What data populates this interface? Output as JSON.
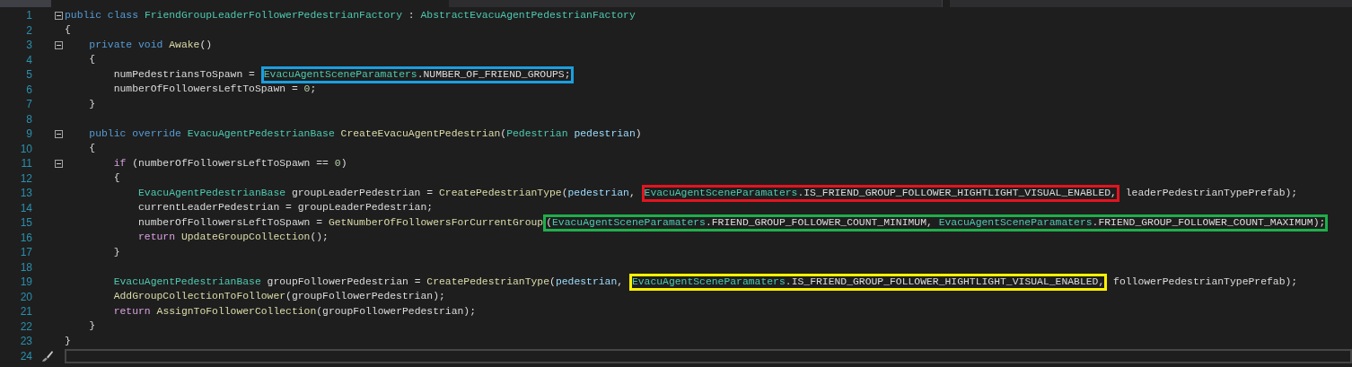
{
  "lines": [
    {
      "number": "1",
      "fold": true,
      "current": false,
      "tokens": [
        {
          "kind": "keyword",
          "text": "public class "
        },
        {
          "kind": "type",
          "text": "FriendGroupLeaderFollowerPedestrianFactory"
        },
        {
          "kind": "plain",
          "text": " : "
        },
        {
          "kind": "type",
          "text": "AbstractEvacuAgentPedestrianFactory"
        }
      ]
    },
    {
      "number": "2",
      "fold": false,
      "current": false,
      "tokens": [
        {
          "kind": "plain",
          "text": "{"
        }
      ]
    },
    {
      "number": "3",
      "fold": true,
      "current": false,
      "tokens": [
        {
          "kind": "keyword",
          "text": "    private void "
        },
        {
          "kind": "method",
          "text": "Awake"
        },
        {
          "kind": "plain",
          "text": "()"
        }
      ]
    },
    {
      "number": "4",
      "fold": false,
      "current": false,
      "tokens": [
        {
          "kind": "plain",
          "text": "    {"
        }
      ]
    },
    {
      "number": "5",
      "fold": false,
      "current": false,
      "tokens": [
        {
          "kind": "plain",
          "text": "        numPedestriansToSpawn = "
        },
        {
          "kind": "box",
          "color": "#1a9fe0",
          "tokens": [
            {
              "kind": "type",
              "text": "EvacuAgentSceneParamaters"
            },
            {
              "kind": "plain",
              "text": ".NUMBER_OF_FRIEND_GROUPS;"
            }
          ]
        }
      ]
    },
    {
      "number": "6",
      "fold": false,
      "current": false,
      "tokens": [
        {
          "kind": "plain",
          "text": "        numberOfFollowersLeftToSpawn = "
        },
        {
          "kind": "number",
          "text": "0"
        },
        {
          "kind": "plain",
          "text": ";"
        }
      ]
    },
    {
      "number": "7",
      "fold": false,
      "current": false,
      "tokens": [
        {
          "kind": "plain",
          "text": "    }"
        }
      ]
    },
    {
      "number": "8",
      "fold": false,
      "current": false
    },
    {
      "number": "9",
      "fold": true,
      "current": false,
      "tokens": [
        {
          "kind": "keyword",
          "text": "    public override "
        },
        {
          "kind": "type",
          "text": "EvacuAgentPedestrianBase "
        },
        {
          "kind": "method",
          "text": "CreateEvacuAgentPedestrian"
        },
        {
          "kind": "plain",
          "text": "("
        },
        {
          "kind": "type",
          "text": "Pedestrian "
        },
        {
          "kind": "param",
          "text": "pedestrian"
        },
        {
          "kind": "plain",
          "text": ")"
        }
      ]
    },
    {
      "number": "10",
      "fold": false,
      "current": false,
      "tokens": [
        {
          "kind": "plain",
          "text": "    {"
        }
      ]
    },
    {
      "number": "11",
      "fold": true,
      "current": false,
      "tokens": [
        {
          "kind": "control",
          "text": "        if"
        },
        {
          "kind": "plain",
          "text": " (numberOfFollowersLeftToSpawn == "
        },
        {
          "kind": "number",
          "text": "0"
        },
        {
          "kind": "plain",
          "text": ")"
        }
      ]
    },
    {
      "number": "12",
      "fold": false,
      "current": false,
      "tokens": [
        {
          "kind": "plain",
          "text": "        {"
        }
      ]
    },
    {
      "number": "13",
      "fold": false,
      "current": false,
      "tokens": [
        {
          "kind": "type",
          "text": "            EvacuAgentPedestrianBase"
        },
        {
          "kind": "plain",
          "text": " groupLeaderPedestrian = "
        },
        {
          "kind": "method",
          "text": "CreatePedestrianType"
        },
        {
          "kind": "plain",
          "text": "("
        },
        {
          "kind": "param",
          "text": "pedestrian"
        },
        {
          "kind": "plain",
          "text": ", "
        },
        {
          "kind": "box",
          "color": "#e3141f",
          "tokens": [
            {
              "kind": "type",
              "text": "EvacuAgentSceneParamaters"
            },
            {
              "kind": "plain",
              "text": ".IS_FRIEND_GROUP_FOLLOWER_HIGHTLIGHT_VISUAL_ENABLED,"
            }
          ]
        },
        {
          "kind": "plain",
          "text": " leaderPedestrianTypePrefab);"
        }
      ]
    },
    {
      "number": "14",
      "fold": false,
      "current": false,
      "tokens": [
        {
          "kind": "plain",
          "text": "            currentLeaderPedestrian = groupLeaderPedestrian;"
        }
      ]
    },
    {
      "number": "15",
      "fold": false,
      "current": false,
      "tokens": [
        {
          "kind": "plain",
          "text": "            numberOfFollowersLeftToSpawn = "
        },
        {
          "kind": "method",
          "text": "GetNumberOfFollowersForCurrentGroup"
        },
        {
          "kind": "box",
          "color": "#1fae4b",
          "tokens": [
            {
              "kind": "plain",
              "text": "("
            },
            {
              "kind": "type",
              "text": "EvacuAgentSceneParamaters"
            },
            {
              "kind": "plain",
              "text": ".FRIEND_GROUP_FOLLOWER_COUNT_MINIMUM, "
            },
            {
              "kind": "type",
              "text": "EvacuAgentSceneParamaters"
            },
            {
              "kind": "plain",
              "text": ".FRIEND_GROUP_FOLLOWER_COUNT_MAXIMUM);"
            }
          ]
        }
      ]
    },
    {
      "number": "16",
      "fold": false,
      "current": false,
      "tokens": [
        {
          "kind": "control",
          "text": "            return "
        },
        {
          "kind": "method",
          "text": "UpdateGroupCollection"
        },
        {
          "kind": "plain",
          "text": "();"
        }
      ]
    },
    {
      "number": "17",
      "fold": false,
      "current": false,
      "tokens": [
        {
          "kind": "plain",
          "text": "        }"
        }
      ]
    },
    {
      "number": "18",
      "fold": false,
      "current": false
    },
    {
      "number": "19",
      "fold": false,
      "current": false,
      "tokens": [
        {
          "kind": "type",
          "text": "        EvacuAgentPedestrianBase"
        },
        {
          "kind": "plain",
          "text": " groupFollowerPedestrian = "
        },
        {
          "kind": "method",
          "text": "CreatePedestrianType"
        },
        {
          "kind": "plain",
          "text": "("
        },
        {
          "kind": "param",
          "text": "pedestrian"
        },
        {
          "kind": "plain",
          "text": ", "
        },
        {
          "kind": "box",
          "color": "#fff200",
          "tokens": [
            {
              "kind": "type",
              "text": "EvacuAgentSceneParamaters"
            },
            {
              "kind": "plain",
              "text": ".IS_FRIEND_GROUP_FOLLOWER_HIGHTLIGHT_VISUAL_ENABLED,"
            }
          ]
        },
        {
          "kind": "plain",
          "text": " followerPedestrianTypePrefab);"
        }
      ]
    },
    {
      "number": "20",
      "fold": false,
      "current": false,
      "tokens": [
        {
          "kind": "method",
          "text": "        AddGroupCollectionToFollower"
        },
        {
          "kind": "plain",
          "text": "(groupFollowerPedestrian);"
        }
      ]
    },
    {
      "number": "21",
      "fold": false,
      "current": false,
      "tokens": [
        {
          "kind": "control",
          "text": "        return "
        },
        {
          "kind": "method",
          "text": "AssignToFollowerCollection"
        },
        {
          "kind": "plain",
          "text": "(groupFollowerPedestrian);"
        }
      ]
    },
    {
      "number": "22",
      "fold": false,
      "current": false,
      "tokens": [
        {
          "kind": "plain",
          "text": "    }"
        }
      ]
    },
    {
      "number": "23",
      "fold": false,
      "current": false,
      "tokens": [
        {
          "kind": "plain",
          "text": "}"
        }
      ]
    },
    {
      "number": "24",
      "fold": false,
      "current": true
    }
  ]
}
